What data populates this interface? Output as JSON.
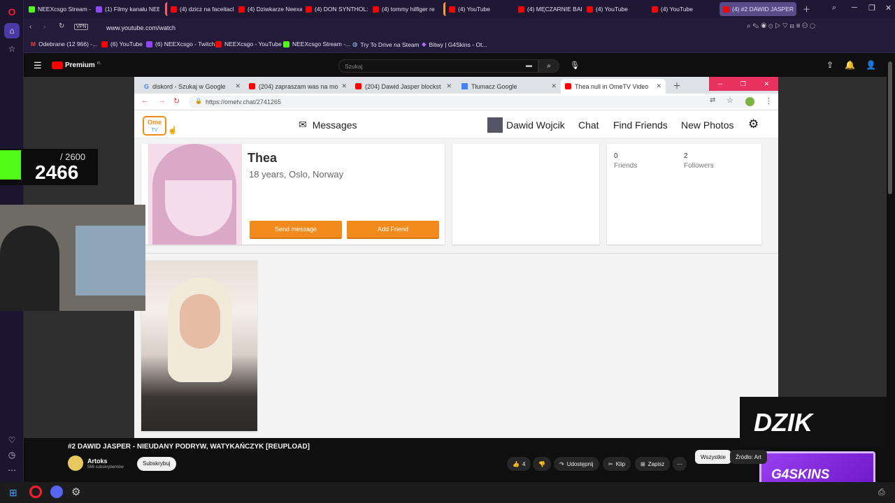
{
  "browser": {
    "tabs": [
      {
        "label": "NEEXcsgo Stream - W",
        "icon": "kick-icon"
      },
      {
        "label": "(1) Filmy kanału NEEX",
        "icon": "twitch-icon"
      },
      {
        "label": "(4) dzicz na faceitach",
        "icon": "youtube-icon"
      },
      {
        "label": "(4) Dziwkarze Neexa",
        "icon": "youtube-icon"
      },
      {
        "label": "(4) DON SYNTHOL: K",
        "icon": "youtube-icon"
      },
      {
        "label": "(4) tommy hilfiger re",
        "icon": "youtube-icon"
      },
      {
        "label": "(4) YouTube",
        "icon": "youtube-icon"
      },
      {
        "label": "(4) MĘCZARNIE BARC",
        "icon": "youtube-icon"
      },
      {
        "label": "(4) YouTube",
        "icon": "youtube-icon"
      },
      {
        "label": "(4) YouTube",
        "icon": "youtube-icon"
      },
      {
        "label": "(4) #2 DAWID JASPER",
        "icon": "youtube-icon"
      }
    ],
    "vpn_label": "VPN",
    "url": "www.youtube.com/watch",
    "bookmarks": [
      {
        "label": "Odebrane (12 966) -...",
        "icon": "gmail-icon"
      },
      {
        "label": "(6) YouTube",
        "icon": "youtube-icon"
      },
      {
        "label": "(6) NEEXcsgo - Twitch",
        "icon": "twitch-icon"
      },
      {
        "label": "NEEXcsgo - YouTube",
        "icon": "youtube-icon"
      },
      {
        "label": "NEEXcsgo Stream -...",
        "icon": "kick-icon"
      },
      {
        "label": "Try To Drive na Steam",
        "icon": "steam-icon"
      },
      {
        "label": "Bitwy | G4Skins - Ot...",
        "icon": "g4skins-icon"
      }
    ]
  },
  "youtube": {
    "logo_text": "Premium",
    "logo_badge": "PL",
    "search_placeholder": "Szukaj",
    "video_title": "#2 DAWID JASPER - NIEUDANY PODRYW, WATYKAŃCZYK [REUPLOAD]",
    "channel_name": "Artoks",
    "subscribers": "566 subskrybentów",
    "subscribe_label": "Subskrybuj",
    "likes": "4",
    "share_label": "Udostępnij",
    "clip_label": "Klip",
    "save_label": "Zapisz",
    "filter_all": "Wszystkie",
    "filter_source": "Źródło: Art"
  },
  "stream_overlay": {
    "score_target": "/ 2600",
    "score_value": "2466",
    "sponsor_1": "DZIK",
    "sponsor_2": "G4SKINS"
  },
  "inner_browser": {
    "tabs": [
      {
        "label": "diskord - Szukaj w Google",
        "icon": "google-icon"
      },
      {
        "label": "(204) zapraszam was na mo",
        "icon": "youtube-icon"
      },
      {
        "label": "(204) Dawid Jasper blockst",
        "icon": "youtube-icon"
      },
      {
        "label": "Tłumacz Google",
        "icon": "translate-icon"
      },
      {
        "label": "Thea null in OmeTV Video",
        "icon": "ometv-icon"
      }
    ],
    "url": "https://ometv.chat/2741265"
  },
  "ometv": {
    "logo_top": "Ome",
    "logo_bottom": "TV",
    "nav_messages": "Messages",
    "nav_user": "Dawid Wojcik",
    "nav_chat": "Chat",
    "nav_find_friends": "Find Friends",
    "nav_new_photos": "New Photos",
    "profile_name": "Thea",
    "profile_details": "18 years, Oslo, Norway",
    "send_message": "Send message",
    "add_friend": "Add Friend",
    "friends_count": "0",
    "friends_label": "Friends",
    "followers_count": "2",
    "followers_label": "Followers"
  },
  "colors": {
    "opera_bg": "#1e1834",
    "ometv_orange": "#f28a1c",
    "avatar_pink": "#d9a9c7",
    "kick_green": "#53fc18",
    "g4skins_purple": "#8a2be2"
  }
}
